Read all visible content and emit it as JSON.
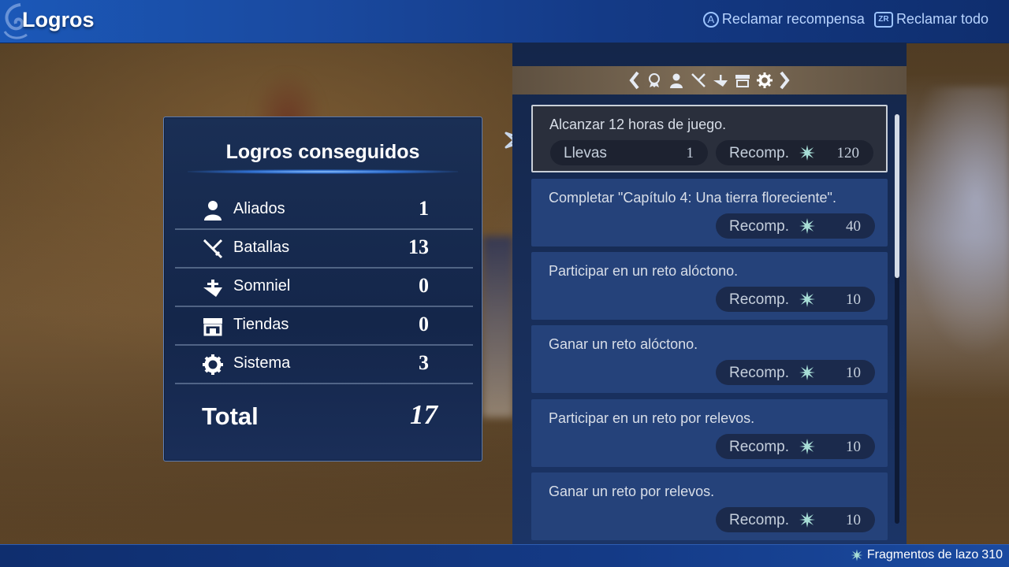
{
  "header": {
    "title": "Logros",
    "actions": [
      {
        "button": "A",
        "label": "Reclamar recompensa"
      },
      {
        "button": "ZR",
        "label": "Reclamar todo"
      }
    ]
  },
  "summary": {
    "heading": "Logros conseguidos",
    "rows": [
      {
        "icon": "person-icon",
        "label": "Aliados",
        "value": "1"
      },
      {
        "icon": "crossed-swords-icon",
        "label": "Batallas",
        "value": "13"
      },
      {
        "icon": "airship-icon",
        "label": "Somniel",
        "value": "0"
      },
      {
        "icon": "shop-icon",
        "label": "Tiendas",
        "value": "0"
      },
      {
        "icon": "gear-icon",
        "label": "Sistema",
        "value": "3"
      }
    ],
    "total_label": "Total",
    "total_value": "17"
  },
  "categories": [
    "medal-icon",
    "person-icon",
    "crossed-swords-icon",
    "airship-icon",
    "shop-icon",
    "gear-icon"
  ],
  "active_category": "gear-icon",
  "achievements": [
    {
      "text": "Alcanzar 12 horas de juego.",
      "progress_label": "Llevas",
      "progress_value": "1",
      "reward_label": "Recomp.",
      "reward_value": "120",
      "selected": true
    },
    {
      "text": "Completar \"Capítulo 4: Una tierra floreciente\".",
      "reward_label": "Recomp.",
      "reward_value": "40"
    },
    {
      "text": "Participar en un reto alóctono.",
      "reward_label": "Recomp.",
      "reward_value": "10"
    },
    {
      "text": "Ganar un reto alóctono.",
      "reward_label": "Recomp.",
      "reward_value": "10"
    },
    {
      "text": "Participar en un reto por relevos.",
      "reward_label": "Recomp.",
      "reward_value": "10"
    },
    {
      "text": "Ganar un reto por relevos.",
      "reward_label": "Recomp.",
      "reward_value": "10"
    }
  ],
  "footer": {
    "label": "Fragmentos de lazo",
    "value": "310"
  },
  "colors": {
    "topbar": "#1a4aa0",
    "panel": "#14264a",
    "item": "#25427a",
    "selected_item": "#2a2f3c",
    "reward_star": "#a7ddd6"
  }
}
